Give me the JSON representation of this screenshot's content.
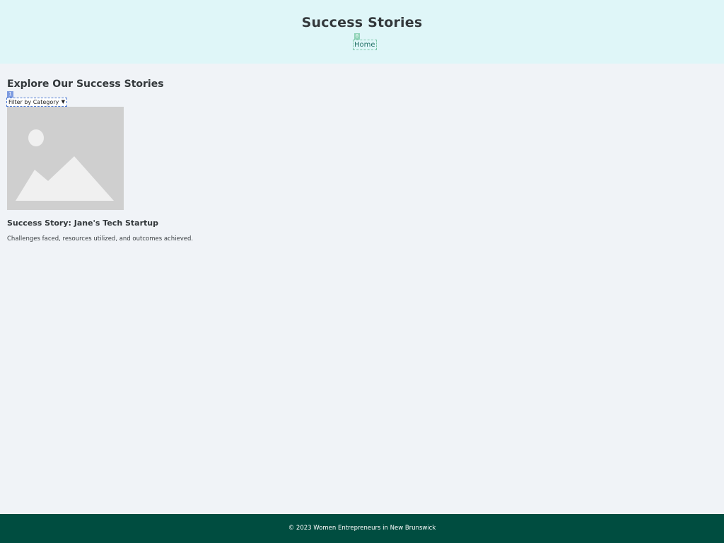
{
  "header": {
    "title": "Success Stories",
    "nav": [
      {
        "badge": "0",
        "label": "Home"
      }
    ]
  },
  "main": {
    "heading": "Explore Our Success Stories",
    "filter": {
      "badge": "1",
      "selected": "Filter by Category"
    },
    "stories": [
      {
        "image_icon": "image-placeholder-icon",
        "title": "Success Story: Jane's Tech Startup",
        "description": "Challenges faced, resources utilized, and outcomes achieved."
      }
    ]
  },
  "footer": {
    "text": "© 2023 Women Entrepreneurs in New Brunswick"
  },
  "colors": {
    "header_bg": "#dff6f8",
    "page_bg": "#f0f3f7",
    "footer_bg": "#004d40",
    "link": "#1f6e63"
  }
}
